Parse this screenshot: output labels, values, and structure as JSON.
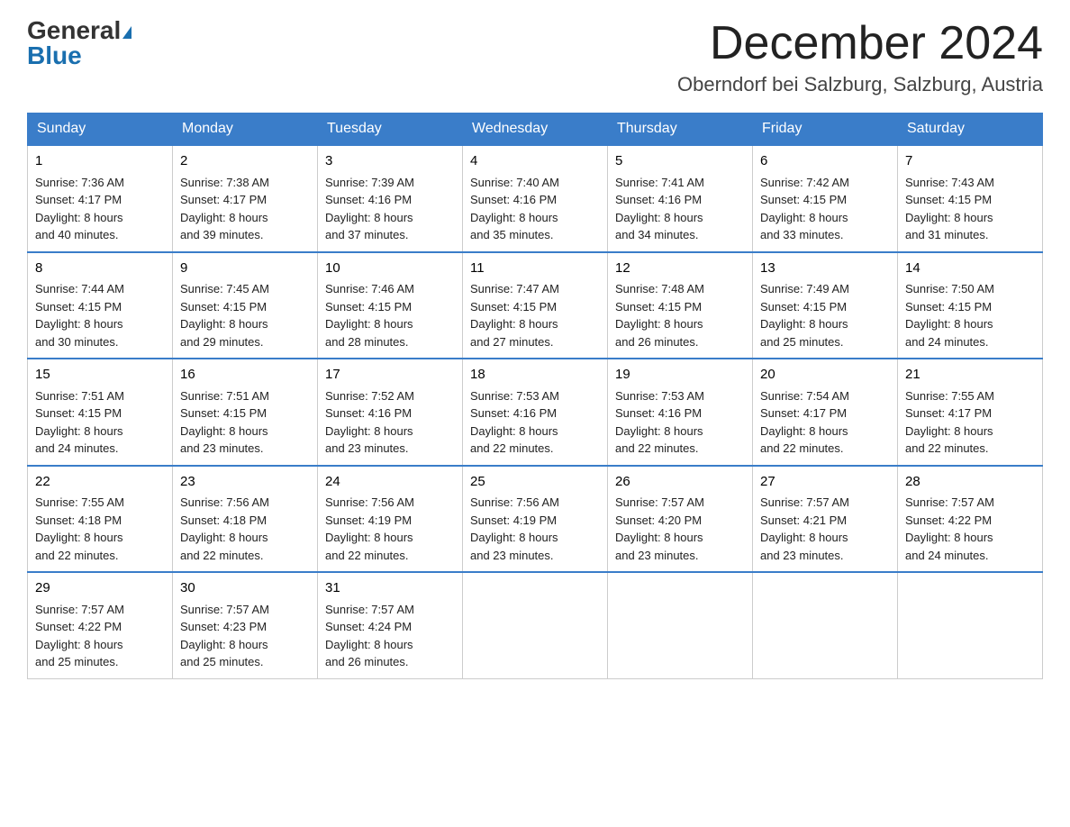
{
  "header": {
    "logo_line1": "General",
    "logo_line2": "Blue",
    "month_title": "December 2024",
    "location": "Oberndorf bei Salzburg, Salzburg, Austria"
  },
  "weekdays": [
    "Sunday",
    "Monday",
    "Tuesday",
    "Wednesday",
    "Thursday",
    "Friday",
    "Saturday"
  ],
  "weeks": [
    [
      {
        "day": "1",
        "sunrise": "7:36 AM",
        "sunset": "4:17 PM",
        "daylight": "8 hours and 40 minutes."
      },
      {
        "day": "2",
        "sunrise": "7:38 AM",
        "sunset": "4:17 PM",
        "daylight": "8 hours and 39 minutes."
      },
      {
        "day": "3",
        "sunrise": "7:39 AM",
        "sunset": "4:16 PM",
        "daylight": "8 hours and 37 minutes."
      },
      {
        "day": "4",
        "sunrise": "7:40 AM",
        "sunset": "4:16 PM",
        "daylight": "8 hours and 35 minutes."
      },
      {
        "day": "5",
        "sunrise": "7:41 AM",
        "sunset": "4:16 PM",
        "daylight": "8 hours and 34 minutes."
      },
      {
        "day": "6",
        "sunrise": "7:42 AM",
        "sunset": "4:15 PM",
        "daylight": "8 hours and 33 minutes."
      },
      {
        "day": "7",
        "sunrise": "7:43 AM",
        "sunset": "4:15 PM",
        "daylight": "8 hours and 31 minutes."
      }
    ],
    [
      {
        "day": "8",
        "sunrise": "7:44 AM",
        "sunset": "4:15 PM",
        "daylight": "8 hours and 30 minutes."
      },
      {
        "day": "9",
        "sunrise": "7:45 AM",
        "sunset": "4:15 PM",
        "daylight": "8 hours and 29 minutes."
      },
      {
        "day": "10",
        "sunrise": "7:46 AM",
        "sunset": "4:15 PM",
        "daylight": "8 hours and 28 minutes."
      },
      {
        "day": "11",
        "sunrise": "7:47 AM",
        "sunset": "4:15 PM",
        "daylight": "8 hours and 27 minutes."
      },
      {
        "day": "12",
        "sunrise": "7:48 AM",
        "sunset": "4:15 PM",
        "daylight": "8 hours and 26 minutes."
      },
      {
        "day": "13",
        "sunrise": "7:49 AM",
        "sunset": "4:15 PM",
        "daylight": "8 hours and 25 minutes."
      },
      {
        "day": "14",
        "sunrise": "7:50 AM",
        "sunset": "4:15 PM",
        "daylight": "8 hours and 24 minutes."
      }
    ],
    [
      {
        "day": "15",
        "sunrise": "7:51 AM",
        "sunset": "4:15 PM",
        "daylight": "8 hours and 24 minutes."
      },
      {
        "day": "16",
        "sunrise": "7:51 AM",
        "sunset": "4:15 PM",
        "daylight": "8 hours and 23 minutes."
      },
      {
        "day": "17",
        "sunrise": "7:52 AM",
        "sunset": "4:16 PM",
        "daylight": "8 hours and 23 minutes."
      },
      {
        "day": "18",
        "sunrise": "7:53 AM",
        "sunset": "4:16 PM",
        "daylight": "8 hours and 22 minutes."
      },
      {
        "day": "19",
        "sunrise": "7:53 AM",
        "sunset": "4:16 PM",
        "daylight": "8 hours and 22 minutes."
      },
      {
        "day": "20",
        "sunrise": "7:54 AM",
        "sunset": "4:17 PM",
        "daylight": "8 hours and 22 minutes."
      },
      {
        "day": "21",
        "sunrise": "7:55 AM",
        "sunset": "4:17 PM",
        "daylight": "8 hours and 22 minutes."
      }
    ],
    [
      {
        "day": "22",
        "sunrise": "7:55 AM",
        "sunset": "4:18 PM",
        "daylight": "8 hours and 22 minutes."
      },
      {
        "day": "23",
        "sunrise": "7:56 AM",
        "sunset": "4:18 PM",
        "daylight": "8 hours and 22 minutes."
      },
      {
        "day": "24",
        "sunrise": "7:56 AM",
        "sunset": "4:19 PM",
        "daylight": "8 hours and 22 minutes."
      },
      {
        "day": "25",
        "sunrise": "7:56 AM",
        "sunset": "4:19 PM",
        "daylight": "8 hours and 23 minutes."
      },
      {
        "day": "26",
        "sunrise": "7:57 AM",
        "sunset": "4:20 PM",
        "daylight": "8 hours and 23 minutes."
      },
      {
        "day": "27",
        "sunrise": "7:57 AM",
        "sunset": "4:21 PM",
        "daylight": "8 hours and 23 minutes."
      },
      {
        "day": "28",
        "sunrise": "7:57 AM",
        "sunset": "4:22 PM",
        "daylight": "8 hours and 24 minutes."
      }
    ],
    [
      {
        "day": "29",
        "sunrise": "7:57 AM",
        "sunset": "4:22 PM",
        "daylight": "8 hours and 25 minutes."
      },
      {
        "day": "30",
        "sunrise": "7:57 AM",
        "sunset": "4:23 PM",
        "daylight": "8 hours and 25 minutes."
      },
      {
        "day": "31",
        "sunrise": "7:57 AM",
        "sunset": "4:24 PM",
        "daylight": "8 hours and 26 minutes."
      },
      null,
      null,
      null,
      null
    ]
  ],
  "labels": {
    "sunrise": "Sunrise:",
    "sunset": "Sunset:",
    "daylight": "Daylight:"
  }
}
